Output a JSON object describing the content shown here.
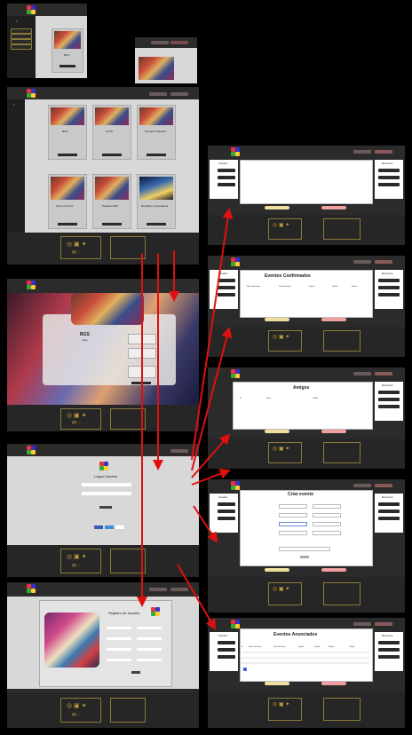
{
  "thumbnails": {
    "home_small": {
      "event_title": "BGS",
      "button": "Ver evento"
    },
    "event_detail": {
      "title": "BGS",
      "subtitle": "Jogo"
    },
    "login": {
      "title": "Logon Usuário",
      "button": "Entrar"
    },
    "register": {
      "title": "Registro de Usuário"
    },
    "eventos_confirmados": {
      "title": "Eventos Confirmados",
      "columns": [
        "Nome do Evento",
        "Data do Evento",
        "Horário",
        "Cidade",
        "Estado"
      ]
    },
    "amigos": {
      "title": "Amigos",
      "columns": [
        "Id",
        "Nome",
        "Cidade"
      ]
    },
    "criar_evento": {
      "title": "Criar evento"
    },
    "eventos_anunciados": {
      "title": "Eventos Anunciados",
      "columns": [
        "Id",
        "Nome do Evento",
        "Data do Evento",
        "Horário",
        "Cidade",
        "Estado",
        "Editar"
      ]
    },
    "perfil": {
      "user_label": "Usuário",
      "right_label": "Recursos"
    },
    "events_grid": [
      "BGS",
      "CCXP",
      "Carnaval Salvador",
      "Anime Friends",
      "Parada LGBT",
      "Réveillon Copacabana"
    ]
  },
  "colors": {
    "arrow": "#e01010",
    "bg": "#000000",
    "dark": "#2b2b2b",
    "panel": "#d8d8d8"
  }
}
